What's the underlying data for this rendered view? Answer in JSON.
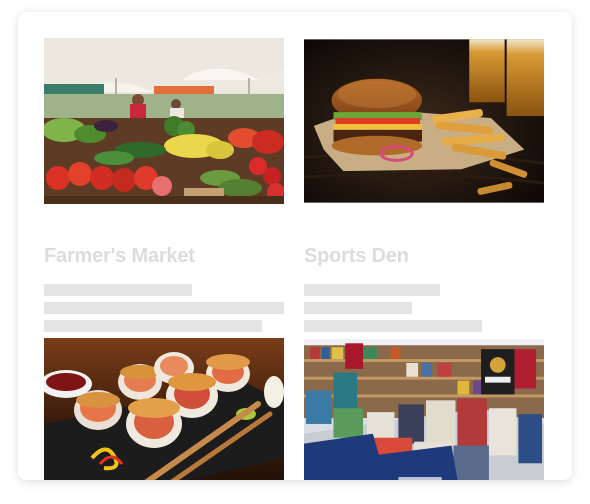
{
  "cards": [
    {
      "title": "Farmer's Market",
      "image_icon": "farmers-market-photo"
    },
    {
      "title": "Sports Den",
      "image_icon": "burger-and-fries-photo"
    },
    {
      "title": "",
      "image_icon": "sushi-rolls-photo"
    },
    {
      "title": "",
      "image_icon": "bookstore-photo"
    }
  ]
}
